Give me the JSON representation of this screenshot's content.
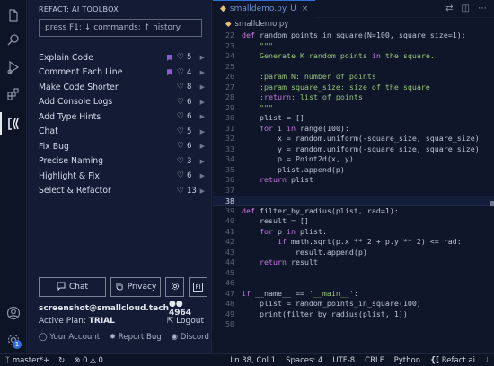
{
  "activity": {
    "items": [
      "files-icon",
      "search-icon",
      "run-debug-icon",
      "extensions-icon",
      "refact-icon"
    ],
    "bottom": [
      "account-icon",
      "settings-gear-icon"
    ],
    "settings_badge": "1"
  },
  "sidebar": {
    "title": "REFACT: AI TOOLBOX",
    "search_placeholder": "press F1; ↓ commands; ↑ history",
    "tools": [
      {
        "label": "Explain Code",
        "flag": true,
        "likes": "5"
      },
      {
        "label": "Comment Each Line",
        "flag": true,
        "likes": "4"
      },
      {
        "label": "Make Code Shorter",
        "flag": false,
        "likes": "8"
      },
      {
        "label": "Add Console Logs",
        "flag": false,
        "likes": "6"
      },
      {
        "label": "Add Type Hints",
        "flag": false,
        "likes": "6"
      },
      {
        "label": "Chat",
        "flag": false,
        "likes": "5"
      },
      {
        "label": "Fix Bug",
        "flag": false,
        "likes": "6"
      },
      {
        "label": "Precise Naming",
        "flag": false,
        "likes": "3"
      },
      {
        "label": "Highlight & Fix",
        "flag": false,
        "likes": "6"
      },
      {
        "label": "Select & Refactor",
        "flag": false,
        "likes": "13"
      }
    ],
    "buttons": {
      "chat": "Chat",
      "privacy": "Privacy",
      "settings_icon": "gear-icon",
      "fi_icon": "FI"
    },
    "account": {
      "email": "screenshot@smallcloud.tech",
      "coins": "4964",
      "plan_label": "Active Plan:",
      "plan": "TRIAL",
      "logout": "Logout"
    },
    "links": {
      "account": "Your Account",
      "bug": "Report Bug",
      "discord": "Discord"
    }
  },
  "editor": {
    "tab": {
      "name": "smalldemo.py",
      "status": "U"
    },
    "breadcrumb": "smalldemo.py",
    "lines": [
      {
        "n": "22",
        "t": "def random_points_in_square(N=100, square_size=1):"
      },
      {
        "n": "23",
        "t": "    \"\"\""
      },
      {
        "n": "24",
        "t": "    Generate K random points in the square."
      },
      {
        "n": "25",
        "t": ""
      },
      {
        "n": "26",
        "t": "    :param N: number of points"
      },
      {
        "n": "27",
        "t": "    :param square_size: size of the square"
      },
      {
        "n": "28",
        "t": "    :return: list of points"
      },
      {
        "n": "29",
        "t": "    \"\"\""
      },
      {
        "n": "30",
        "t": "    plist = []"
      },
      {
        "n": "31",
        "t": "    for i in range(100):"
      },
      {
        "n": "32",
        "t": "        x = random.uniform(-square_size, square_size)"
      },
      {
        "n": "33",
        "t": "        y = random.uniform(-square_size, square_size)"
      },
      {
        "n": "34",
        "t": "        p = Point2d(x, y)"
      },
      {
        "n": "35",
        "t": "        plist.append(p)"
      },
      {
        "n": "36",
        "t": "    return plist"
      },
      {
        "n": "37",
        "t": ""
      },
      {
        "n": "38",
        "t": ""
      },
      {
        "n": "39",
        "t": "def filter_by_radius(plist, rad=1):"
      },
      {
        "n": "40",
        "t": "    result = []"
      },
      {
        "n": "41",
        "t": "    for p in plist:"
      },
      {
        "n": "42",
        "t": "        if math.sqrt(p.x ** 2 + p.y ** 2) <= rad:"
      },
      {
        "n": "43",
        "t": "            result.append(p)"
      },
      {
        "n": "44",
        "t": "    return result"
      },
      {
        "n": "45",
        "t": ""
      },
      {
        "n": "46",
        "t": ""
      },
      {
        "n": "47",
        "t": "if __name__ == '__main__':"
      },
      {
        "n": "48",
        "t": "    plist = random_points_in_square(100)"
      },
      {
        "n": "49",
        "t": "    print(filter_by_radius(plist, 1))"
      },
      {
        "n": "50",
        "t": ""
      }
    ],
    "current_line": "38"
  },
  "status": {
    "branch": "master*+",
    "errors": "0",
    "warnings": "0",
    "position": "Ln 38, Col 1",
    "spaces": "Spaces: 4",
    "encoding": "UTF-8",
    "eol": "CRLF",
    "language": "Python",
    "refact": "Refact.ai"
  },
  "colors": {
    "accent": "#2f6fd6",
    "flag": "#8c5cd6",
    "keyword": "#c678dd",
    "string": "#98c379"
  }
}
